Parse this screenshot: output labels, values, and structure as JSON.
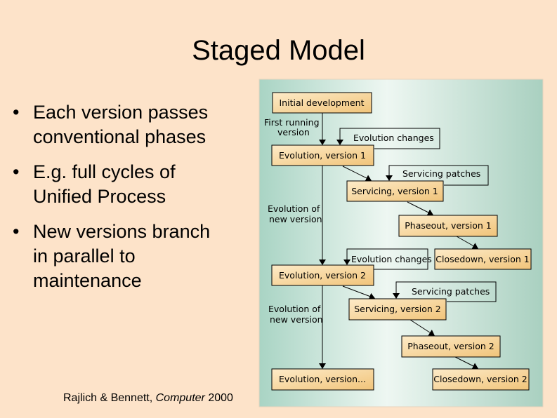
{
  "slide": {
    "title": "Staged Model",
    "bullets": [
      [
        "Each version passes",
        "conventional phases"
      ],
      [
        "E.g. full cycles of",
        "Unified Process"
      ],
      [
        "New versions branch",
        "in parallel to",
        "maintenance"
      ]
    ],
    "bullet_glyph": "•",
    "citation": {
      "authors": "Rajlich & Bennett, ",
      "journal": "Computer",
      "year": " 2000"
    }
  },
  "diagram": {
    "colors": {
      "box_fill_light": "#fdebc8",
      "box_fill_dark": "#f1c47a",
      "bg_edge": "#a9d4c4",
      "bg_center": "#eef7f2"
    },
    "stages": {
      "initial": "Initial development",
      "evo1": "Evolution, version 1",
      "serv1": "Servicing, version 1",
      "phase1": "Phaseout, version 1",
      "close1": "Closedown, version 1",
      "evo2": "Evolution, version 2",
      "serv2": "Servicing, version 2",
      "phase2": "Phaseout, version 2",
      "evoN": "Evolution, version...",
      "close2": "Closedown, version 2"
    },
    "inputs": {
      "evo_changes1": "Evolution changes",
      "serv_patches1": "Servicing patches",
      "evo_changes2": "Evolution changes",
      "serv_patches2": "Servicing patches"
    },
    "labels": {
      "first_running": [
        "First running",
        "version"
      ],
      "evo_new1": [
        "Evolution of",
        "new version"
      ],
      "evo_new2": [
        "Evolution of",
        "new version"
      ]
    }
  }
}
